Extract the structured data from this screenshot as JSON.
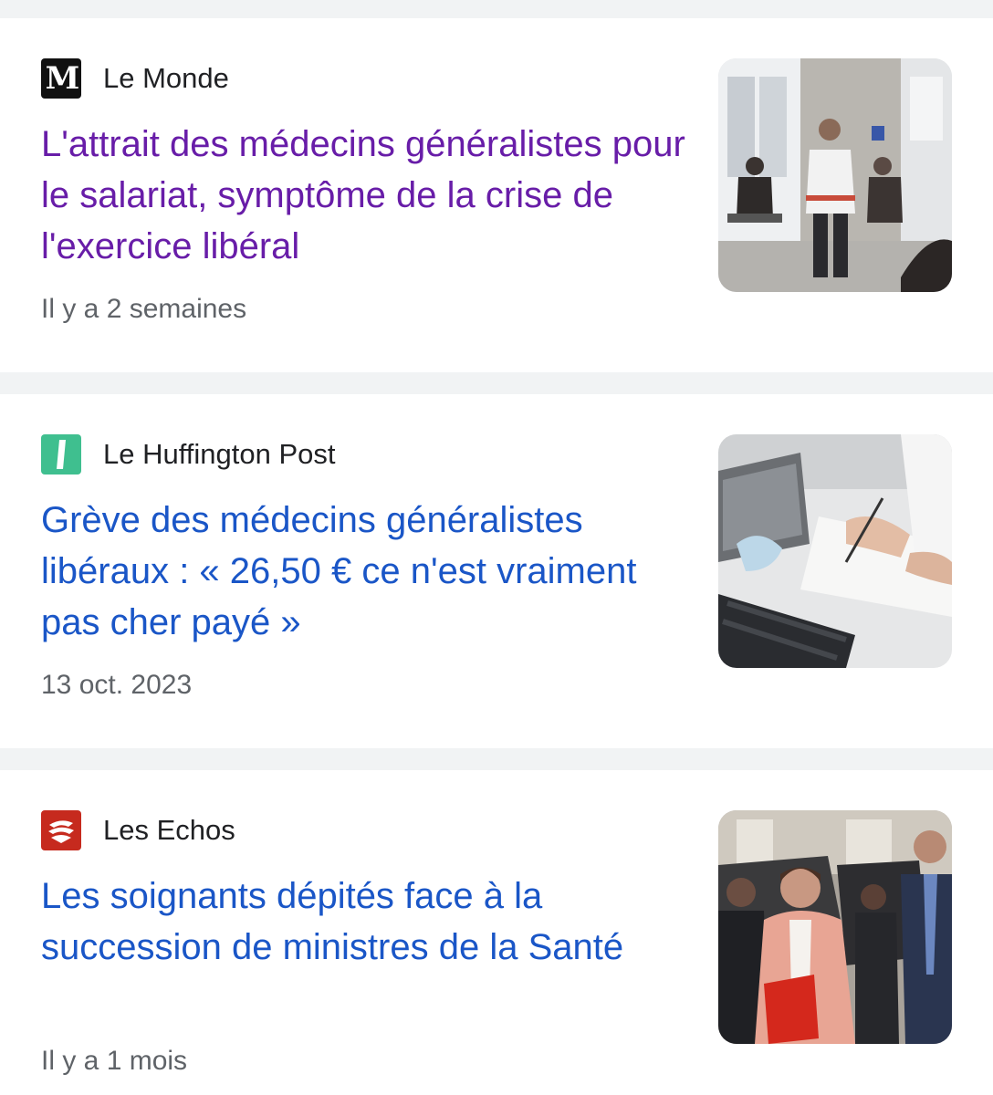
{
  "articles": [
    {
      "source": "Le Monde",
      "logo_icon": "le-monde-logo-icon",
      "logo_glyph": "M",
      "headline": "L'attrait des médecins généralistes pour le salariat, symptôme de la crise de l'exercice libéral",
      "time": "Il y a 2 semaines",
      "visited": true,
      "thumbnail_icon": "clinic-waiting-room-photo"
    },
    {
      "source": "Le Huffington Post",
      "logo_icon": "huffington-post-logo-icon",
      "headline": "Grève des médecins généralistes libéraux : « 26,50 € ce n'est vraiment pas cher payé »",
      "time": "13 oct. 2023",
      "visited": false,
      "thumbnail_icon": "doctor-writing-prescription-photo"
    },
    {
      "source": "Les Echos",
      "logo_icon": "les-echos-logo-icon",
      "headline": "Les soignants dépités face à la succession de ministres de la Santé",
      "time": "Il y a 1 mois",
      "visited": false,
      "thumbnail_icon": "minister-walking-photo"
    }
  ],
  "colors": {
    "visited_link": "#681da8",
    "link": "#1a56c7",
    "meta_text": "#5f6368",
    "separator": "#f1f3f4"
  }
}
